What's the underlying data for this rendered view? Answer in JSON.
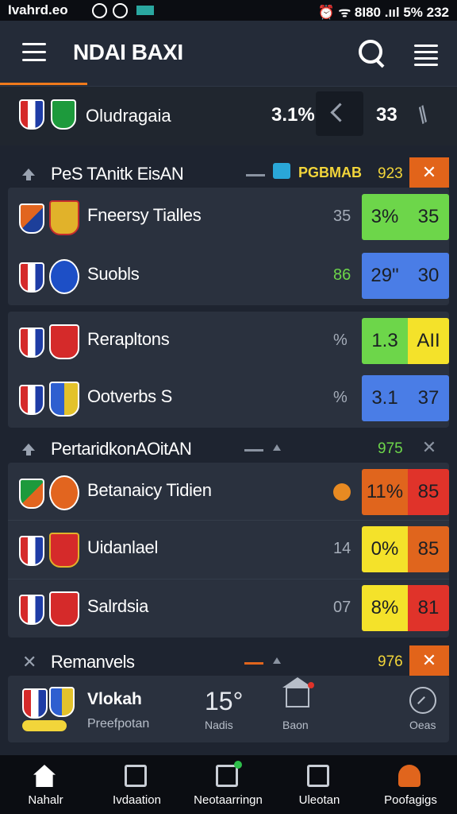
{
  "status_bar": {
    "left_text": "Ivahrd.eo",
    "right_text": "⏰ ᯤ 8I80 .ııl 5% 232"
  },
  "app_bar": {
    "title": "NDAI BAXI"
  },
  "match_bar": {
    "name": "Oludragaia",
    "percent": "3.1%",
    "number": "33"
  },
  "sections": [
    {
      "title": "PeS TAnitk EisAN",
      "flag_text": "PGBMAB",
      "number": "923",
      "close": "✕"
    },
    {
      "title": "PertaridkonAOitAN",
      "number": "975",
      "close": "✕"
    },
    {
      "title": "Remanvels",
      "number": "976",
      "close": "✕"
    }
  ],
  "rows": [
    {
      "name": "Fneersy Tialles",
      "count": "35",
      "odds1": "3%",
      "odds2": "35"
    },
    {
      "name": "Suobls",
      "count": "86",
      "odds1": "29\"",
      "odds2": "30"
    },
    {
      "name": "Rerapltons",
      "count": "%",
      "odds1": "1.3",
      "odds2": "AII"
    },
    {
      "name": "Ootverbs S",
      "count": "%",
      "odds1": "3.1",
      "odds2": "37"
    },
    {
      "name": "Betanaicy Tidien",
      "count": "",
      "odds1": "11%",
      "odds2": "85"
    },
    {
      "name": "Uidanlael",
      "count": "14",
      "odds1": "0%",
      "odds2": "85"
    },
    {
      "name": "Salrdsia",
      "count": "07",
      "odds1": "8%",
      "odds2": "81"
    }
  ],
  "bottom_card": {
    "name": "Vlokah",
    "sub": "Preefpotan",
    "big": "15°",
    "label1": "Nadis",
    "label2": "Baon",
    "label3": "Oeas"
  },
  "nav": [
    {
      "label": "Nahalr"
    },
    {
      "label": "Ivdaation"
    },
    {
      "label": "Neotaarringn"
    },
    {
      "label": "Uleotan"
    },
    {
      "label": "Poofagigs"
    }
  ]
}
